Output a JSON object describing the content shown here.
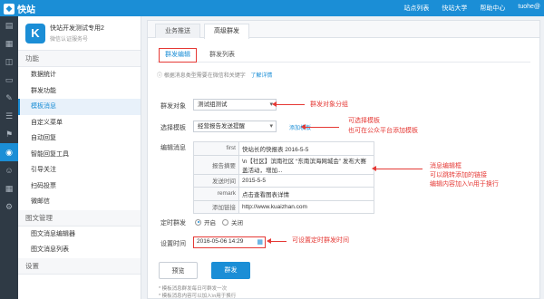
{
  "app": {
    "logo": "快站",
    "nav": [
      "站点列表",
      "快站大学",
      "帮助中心",
      "tuohe@"
    ]
  },
  "rail_icons": [
    "layers-icon",
    "store-icon",
    "cart-icon",
    "document-icon",
    "edit-icon",
    "list-icon",
    "flag-icon",
    "wechat-icon",
    "user-icon",
    "grid-icon",
    "gear-icon"
  ],
  "account": {
    "logo": "K",
    "name": "快站开发测试专用2 ",
    "sub": "微信认证服务号"
  },
  "menu": {
    "section1": "功能",
    "items1": [
      "数据统计",
      "群发功能",
      "模板消息",
      "自定义菜单",
      "自动回复",
      "智能回复工具",
      "引导关注",
      "扫码投票",
      "微邮信"
    ],
    "section2": "图文管理",
    "items2": [
      "图文消息编辑器",
      "图文消息列表"
    ],
    "section3": "设置"
  },
  "tabs": {
    "t1": "业务推送",
    "t2": "高级群发",
    "sub1": "群发编辑",
    "sub2": "群发列表"
  },
  "notice": {
    "text": "根据消息类型需要在微信和关键字",
    "link": "了解详情"
  },
  "form": {
    "target_label": "群发对象",
    "target_value": "测试组测试",
    "template_label": "选择模板",
    "template_value": "经营报告发送提醒",
    "add_template": "添加模板",
    "edit_label": "编辑消息",
    "rows": [
      {
        "k": "first",
        "v": "快站长的快报表 2016-5-5"
      },
      {
        "k": "报告摘要",
        "v": "\\n【社区】滨南社区 “东南滨海网城会” 发布大赛盖活动，增加..."
      },
      {
        "k": "发送时间",
        "v": "2015-5-5"
      },
      {
        "k": "remark",
        "v": "点击查看图表详情"
      },
      {
        "k": "添加链接",
        "v": "http://www.kuaizhan.com"
      }
    ],
    "timer_label": "定时群发",
    "on_label": "开启",
    "off_label": "关闭",
    "time_label": "设置时间",
    "time_value": "2016-05-06 14:29",
    "preview_btn": "预览",
    "send_btn": "群发",
    "tip1": "* 模板消息群发每日可群发一次",
    "tip2": "* 模板消息内容可以加入\\n用于换行"
  },
  "annotations": {
    "a1": "群发对象分组",
    "a2": "可选择模板",
    "a2b": "也可在公众平台添加模板",
    "a3": "消息编辑框",
    "a3b": "可以跳转添加的链接",
    "a3c": "编辑内容加入\\n用于换行",
    "a4": "可设置定时群发时间"
  },
  "colors": {
    "brand": "#1b8ed6",
    "annotation": "#e53935"
  }
}
